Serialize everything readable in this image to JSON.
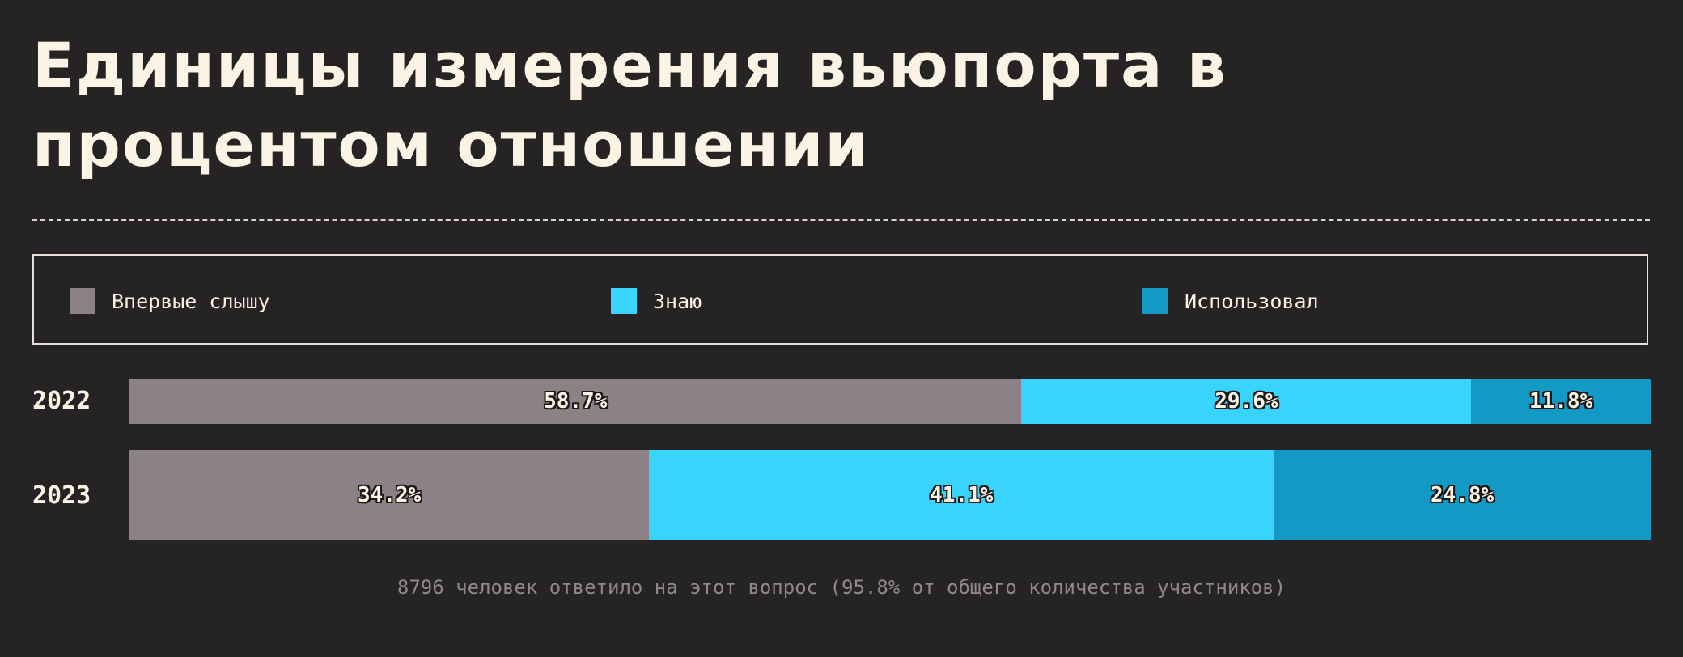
{
  "title": "Единицы измерения вьюпорта в процентом отношении",
  "footnote": "8796 человек ответило на этот вопрос (95.8% от общего количества участников)",
  "chart_data": {
    "type": "bar",
    "orientation": "horizontal",
    "stacked": "percent",
    "categories": [
      "2022",
      "2023"
    ],
    "series": [
      {
        "name": "Впервые слышу",
        "color": "#8c8186",
        "values": [
          58.7,
          34.2
        ],
        "labels": [
          "58.7%",
          "34.2%"
        ]
      },
      {
        "name": "Знаю",
        "color": "#38d4fd",
        "values": [
          29.6,
          41.1
        ],
        "labels": [
          "29.6%",
          "41.1%"
        ]
      },
      {
        "name": "Использовал",
        "color": "#139ac4",
        "values": [
          11.8,
          24.8
        ],
        "labels": [
          "11.8%",
          "24.8%"
        ]
      }
    ],
    "legend_position": "top",
    "xlim": [
      0,
      100
    ],
    "grid": false
  }
}
